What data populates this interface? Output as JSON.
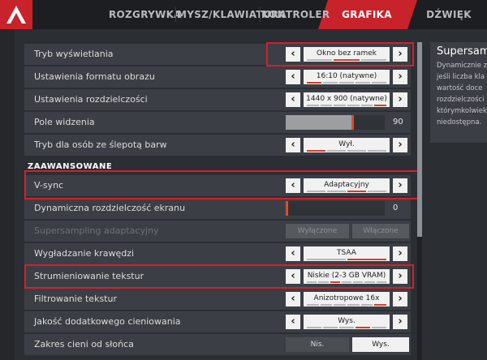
{
  "tabs": [
    {
      "label": "ROZGRYWKA"
    },
    {
      "label": "MYSZ/KLAWIATURA"
    },
    {
      "label": "KONTROLER"
    },
    {
      "label": "GRAFIKA"
    },
    {
      "label": "DŹWIĘK"
    }
  ],
  "active_tab": "GRAFIKA",
  "settings": {
    "display_mode": {
      "label": "Tryb wyświetlania",
      "value": "Okno bez ramek"
    },
    "aspect_ratio": {
      "label": "Ustawienia formatu obrazu",
      "value": "16:10 (natywne)"
    },
    "resolution": {
      "label": "Ustawienia rozdzielczości",
      "value": "1440 x 900 (natywne)"
    },
    "fov": {
      "label": "Pole widzenia",
      "value": "90",
      "level": 0.69
    },
    "colorblind": {
      "label": "Tryb dla osób ze ślepotą barw",
      "value": "Wył."
    },
    "section_advanced": "ZAAWANSOWANE",
    "vsync": {
      "label": "V-sync",
      "value": "Adaptacyjny"
    },
    "dynamic_res": {
      "label": "Dynamiczna rozdzielczość ekranu",
      "value": "0",
      "level": 0.0
    },
    "adaptive_ss": {
      "label": "Supersampling adaptacyjny",
      "option_a": "Wyłączone",
      "option_b": "Włączone"
    },
    "antialiasing": {
      "label": "Wygładzanie krawędzi",
      "value": "TSAA"
    },
    "texture_streaming": {
      "label": "Strumieniowanie tekstur",
      "value": "Niskie (2-3 GB VRAM)"
    },
    "texture_filtering": {
      "label": "Filtrowanie tekstur",
      "value": "Anizotropowe 16x"
    },
    "ambient_occlusion": {
      "label": "Jakość dodatkowego cieniowania",
      "value": "Wys."
    },
    "sun_shadow": {
      "label": "Zakres cieni od słońca",
      "option_a": "Nis.",
      "option_b": "Wys."
    }
  },
  "description": {
    "title": "Supersam",
    "lines": [
      "Dynamicznie z",
      "jeśli liczba kla",
      "wartość doce",
      "rozdzielczości",
      "którymkolwiek",
      "niedostępna."
    ]
  }
}
